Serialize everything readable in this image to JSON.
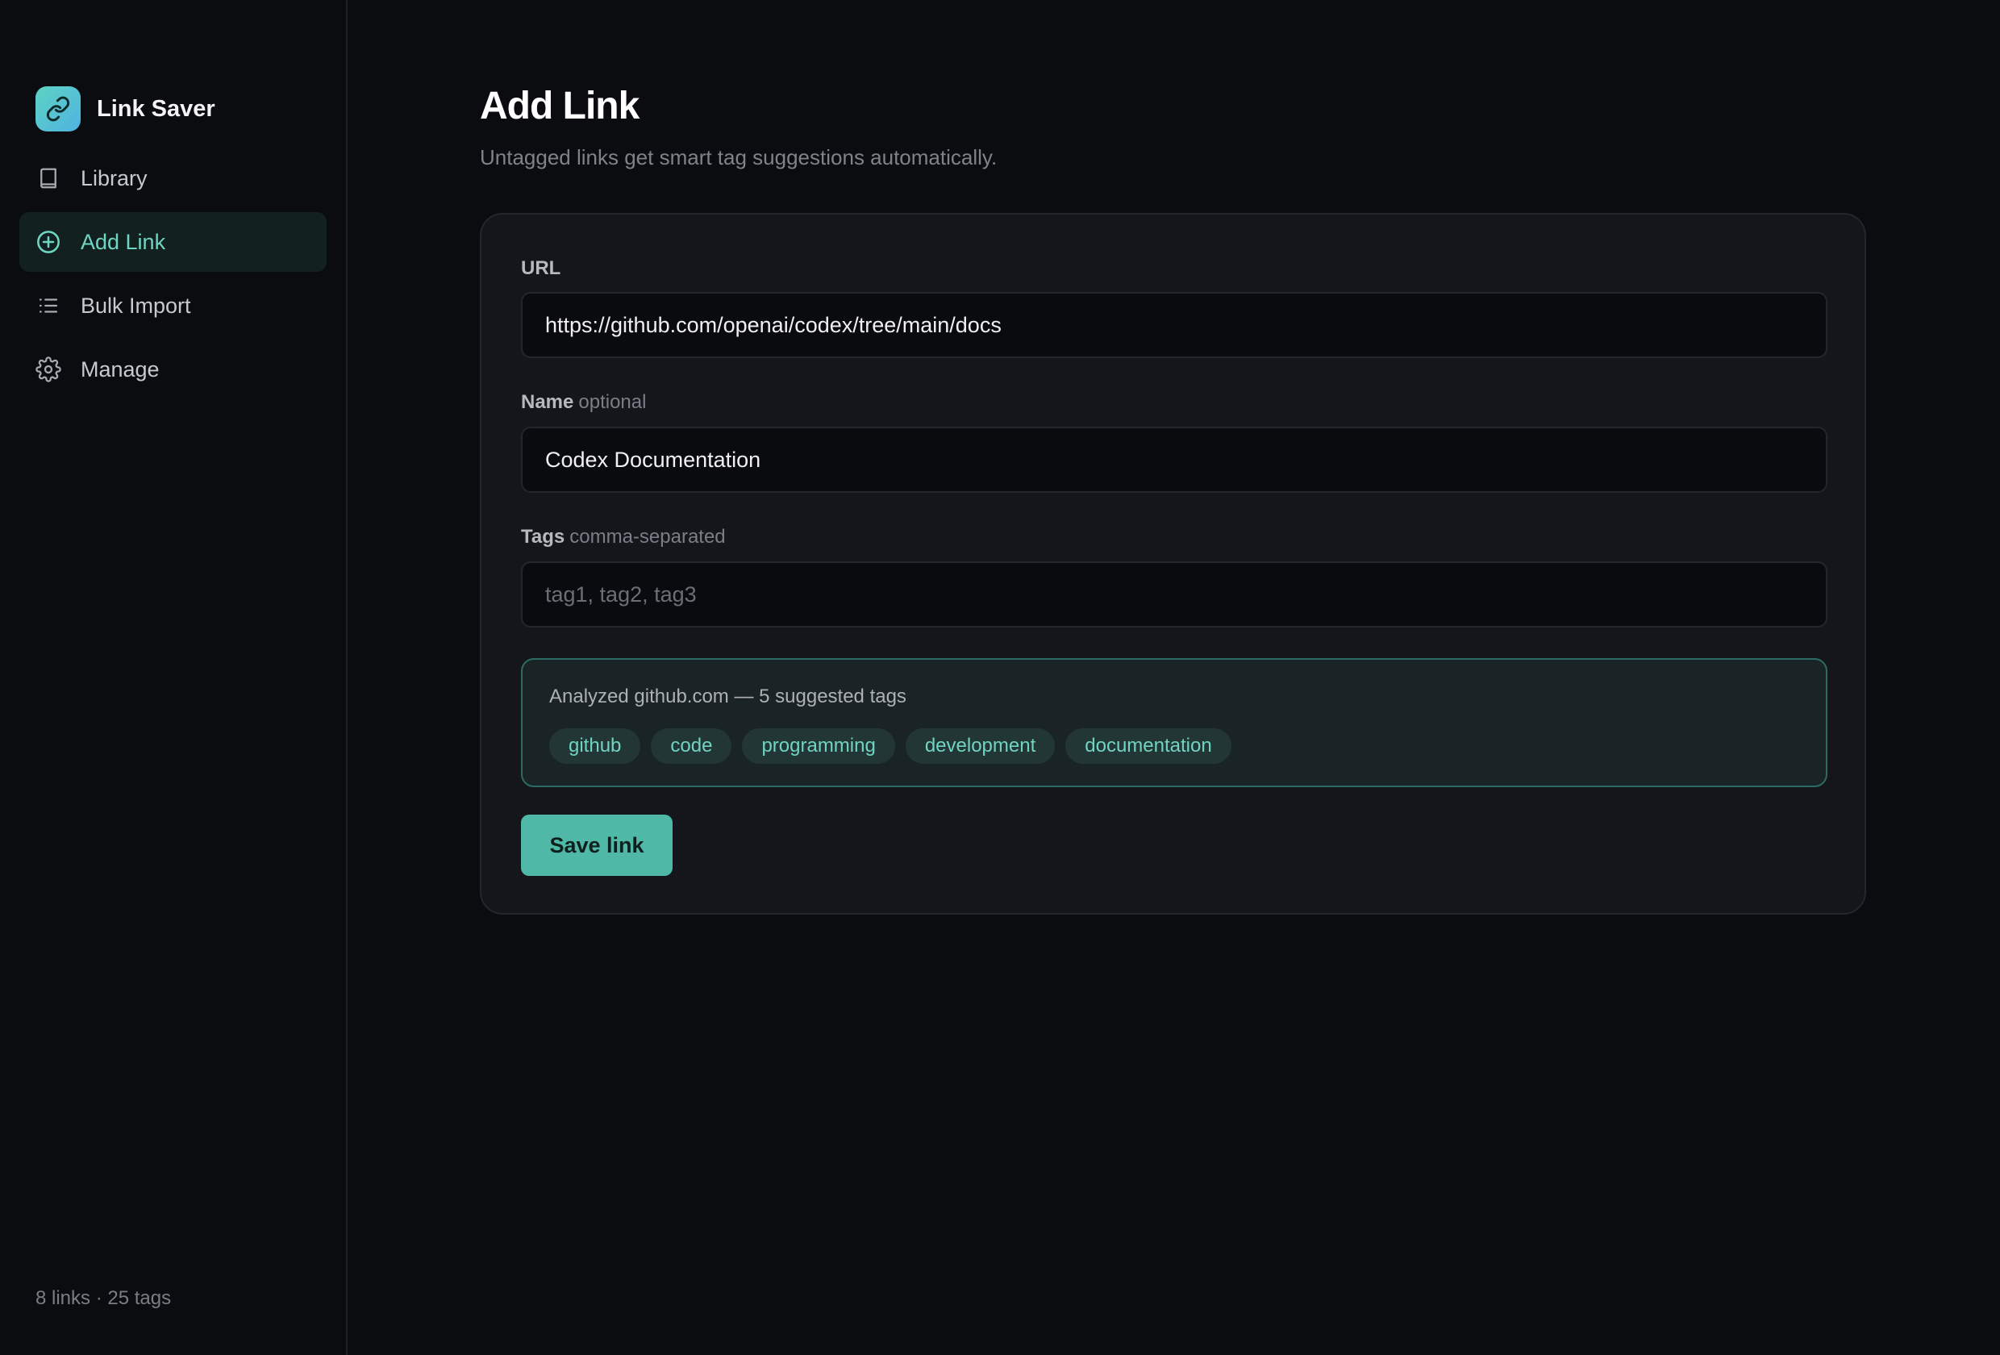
{
  "app": {
    "name": "Link Saver",
    "logo_icon": "link-icon",
    "accent_color": "#4fb8a6"
  },
  "sidebar": {
    "items": [
      {
        "label": "Library",
        "icon": "book-icon",
        "active": false
      },
      {
        "label": "Add Link",
        "icon": "plus-circle-icon",
        "active": true
      },
      {
        "label": "Bulk Import",
        "icon": "list-icon",
        "active": false
      },
      {
        "label": "Manage",
        "icon": "gear-icon",
        "active": false
      }
    ],
    "footer": "8 links · 25 tags"
  },
  "page": {
    "title": "Add Link",
    "subtitle": "Untagged links get smart tag suggestions automatically."
  },
  "form": {
    "url": {
      "label": "URL",
      "value": "https://github.com/openai/codex/tree/main/docs"
    },
    "name": {
      "label": "Name",
      "hint": "optional",
      "value": "Codex Documentation"
    },
    "tags": {
      "label": "Tags",
      "hint": "comma-separated",
      "value": "",
      "placeholder": "tag1, tag2, tag3"
    },
    "suggestions": {
      "text": "Analyzed github.com — 5 suggested tags",
      "tags": [
        "github",
        "code",
        "programming",
        "development",
        "documentation"
      ]
    },
    "save_label": "Save link"
  }
}
